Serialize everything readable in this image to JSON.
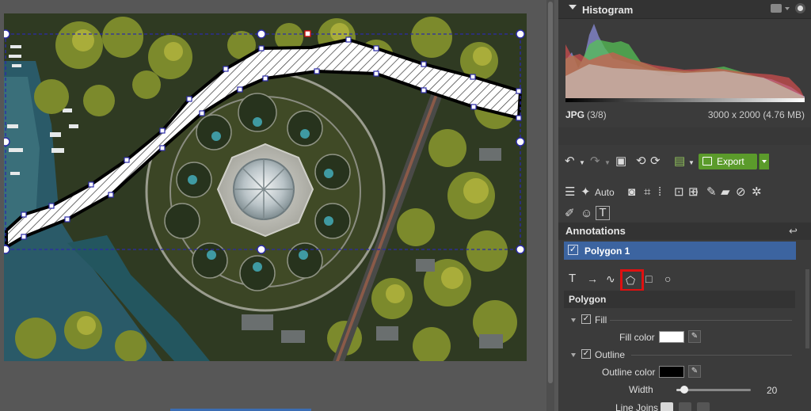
{
  "histogram": {
    "title": "Histogram",
    "file_format": "JPG",
    "file_index": "(3/8)",
    "file_dims": "3000 x 2000 (4.76 MB)"
  },
  "toolbar": {
    "export_label": "Export",
    "auto_label": "Auto"
  },
  "annotations": {
    "title": "Annotations",
    "items": [
      {
        "label": "Polygon 1",
        "checked": true
      }
    ]
  },
  "polygon_props": {
    "section_title": "Polygon",
    "fill_label": "Fill",
    "fill_checked": true,
    "fill_color_label": "Fill color",
    "fill_color": "#ffffff",
    "outline_label": "Outline",
    "outline_checked": true,
    "outline_color_label": "Outline color",
    "outline_color": "#000000",
    "width_label": "Width",
    "width_value": "20",
    "width_fraction": 0.11,
    "line_joins_label": "Line Joins"
  },
  "colors": {
    "accent_blue": "#3c64a0",
    "export_green": "#5b9b2b",
    "highlight_red": "#e01010",
    "panel_bg": "#3b3b3b"
  }
}
